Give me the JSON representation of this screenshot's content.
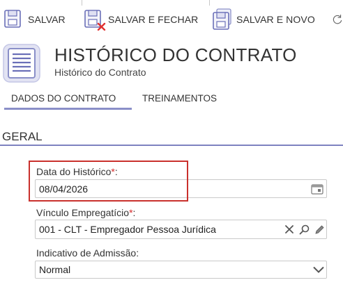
{
  "toolbar": {
    "save_label": "SALVAR",
    "save_close_label": "SALVAR E FECHAR",
    "save_new_label": "SALVAR E NOVO"
  },
  "header": {
    "title": "HISTÓRICO DO CONTRATO",
    "subtitle": "Histórico do Contrato"
  },
  "tabs": [
    {
      "label": "DADOS DO CONTRATO",
      "active": true
    },
    {
      "label": "TREINAMENTOS",
      "active": false
    }
  ],
  "section": {
    "title": "GERAL"
  },
  "fields": {
    "data_historico": {
      "label": "Data do Histórico",
      "required_mark": "*",
      "colon": ":",
      "value": "08/04/2026"
    },
    "vinculo": {
      "label": "Vínculo Empregatício",
      "required_mark": "*",
      "colon": ":",
      "value": "001 - CLT - Empregador Pessoa Jurídica"
    },
    "indicativo": {
      "label": "Indicativo de Admissão:",
      "value": "Normal"
    }
  },
  "colors": {
    "accent": "#7d82c0",
    "required": "#d42a2a",
    "highlight_border": "#c9302c",
    "icon_blue": "#5a5fb0"
  },
  "icons": [
    "floppy-disk-icon",
    "floppy-disk-close-icon",
    "floppy-disk-new-icon",
    "refresh-icon",
    "document-lines-icon",
    "calendar-icon",
    "clear-x-icon",
    "search-icon",
    "edit-pencil-icon",
    "chevron-down-icon"
  ]
}
